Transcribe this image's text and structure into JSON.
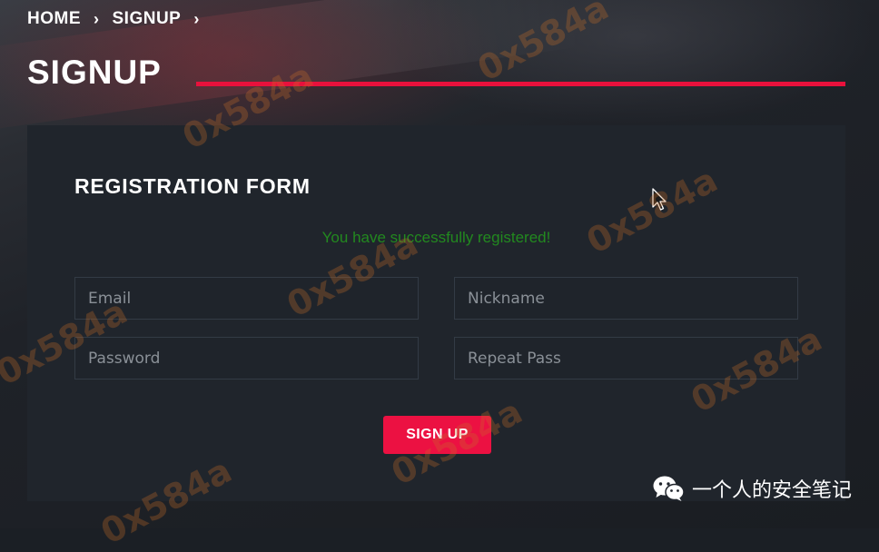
{
  "breadcrumb": {
    "home": "HOME",
    "signup": "SIGNUP"
  },
  "page": {
    "title": "SIGNUP"
  },
  "form": {
    "title": "REGISTRATION FORM",
    "success_message": "You have successfully registered!",
    "email_placeholder": "Email",
    "nickname_placeholder": "Nickname",
    "password_placeholder": "Password",
    "repeat_pass_placeholder": "Repeat Pass",
    "submit_label": "SIGN UP"
  },
  "watermark": {
    "text": "0x584a"
  },
  "wechat": {
    "account": "一个人的安全笔记",
    "icon": "wechat-icon"
  },
  "colors": {
    "accent": "#e8113c",
    "success": "#22891f",
    "card_bg": "#20252c"
  }
}
